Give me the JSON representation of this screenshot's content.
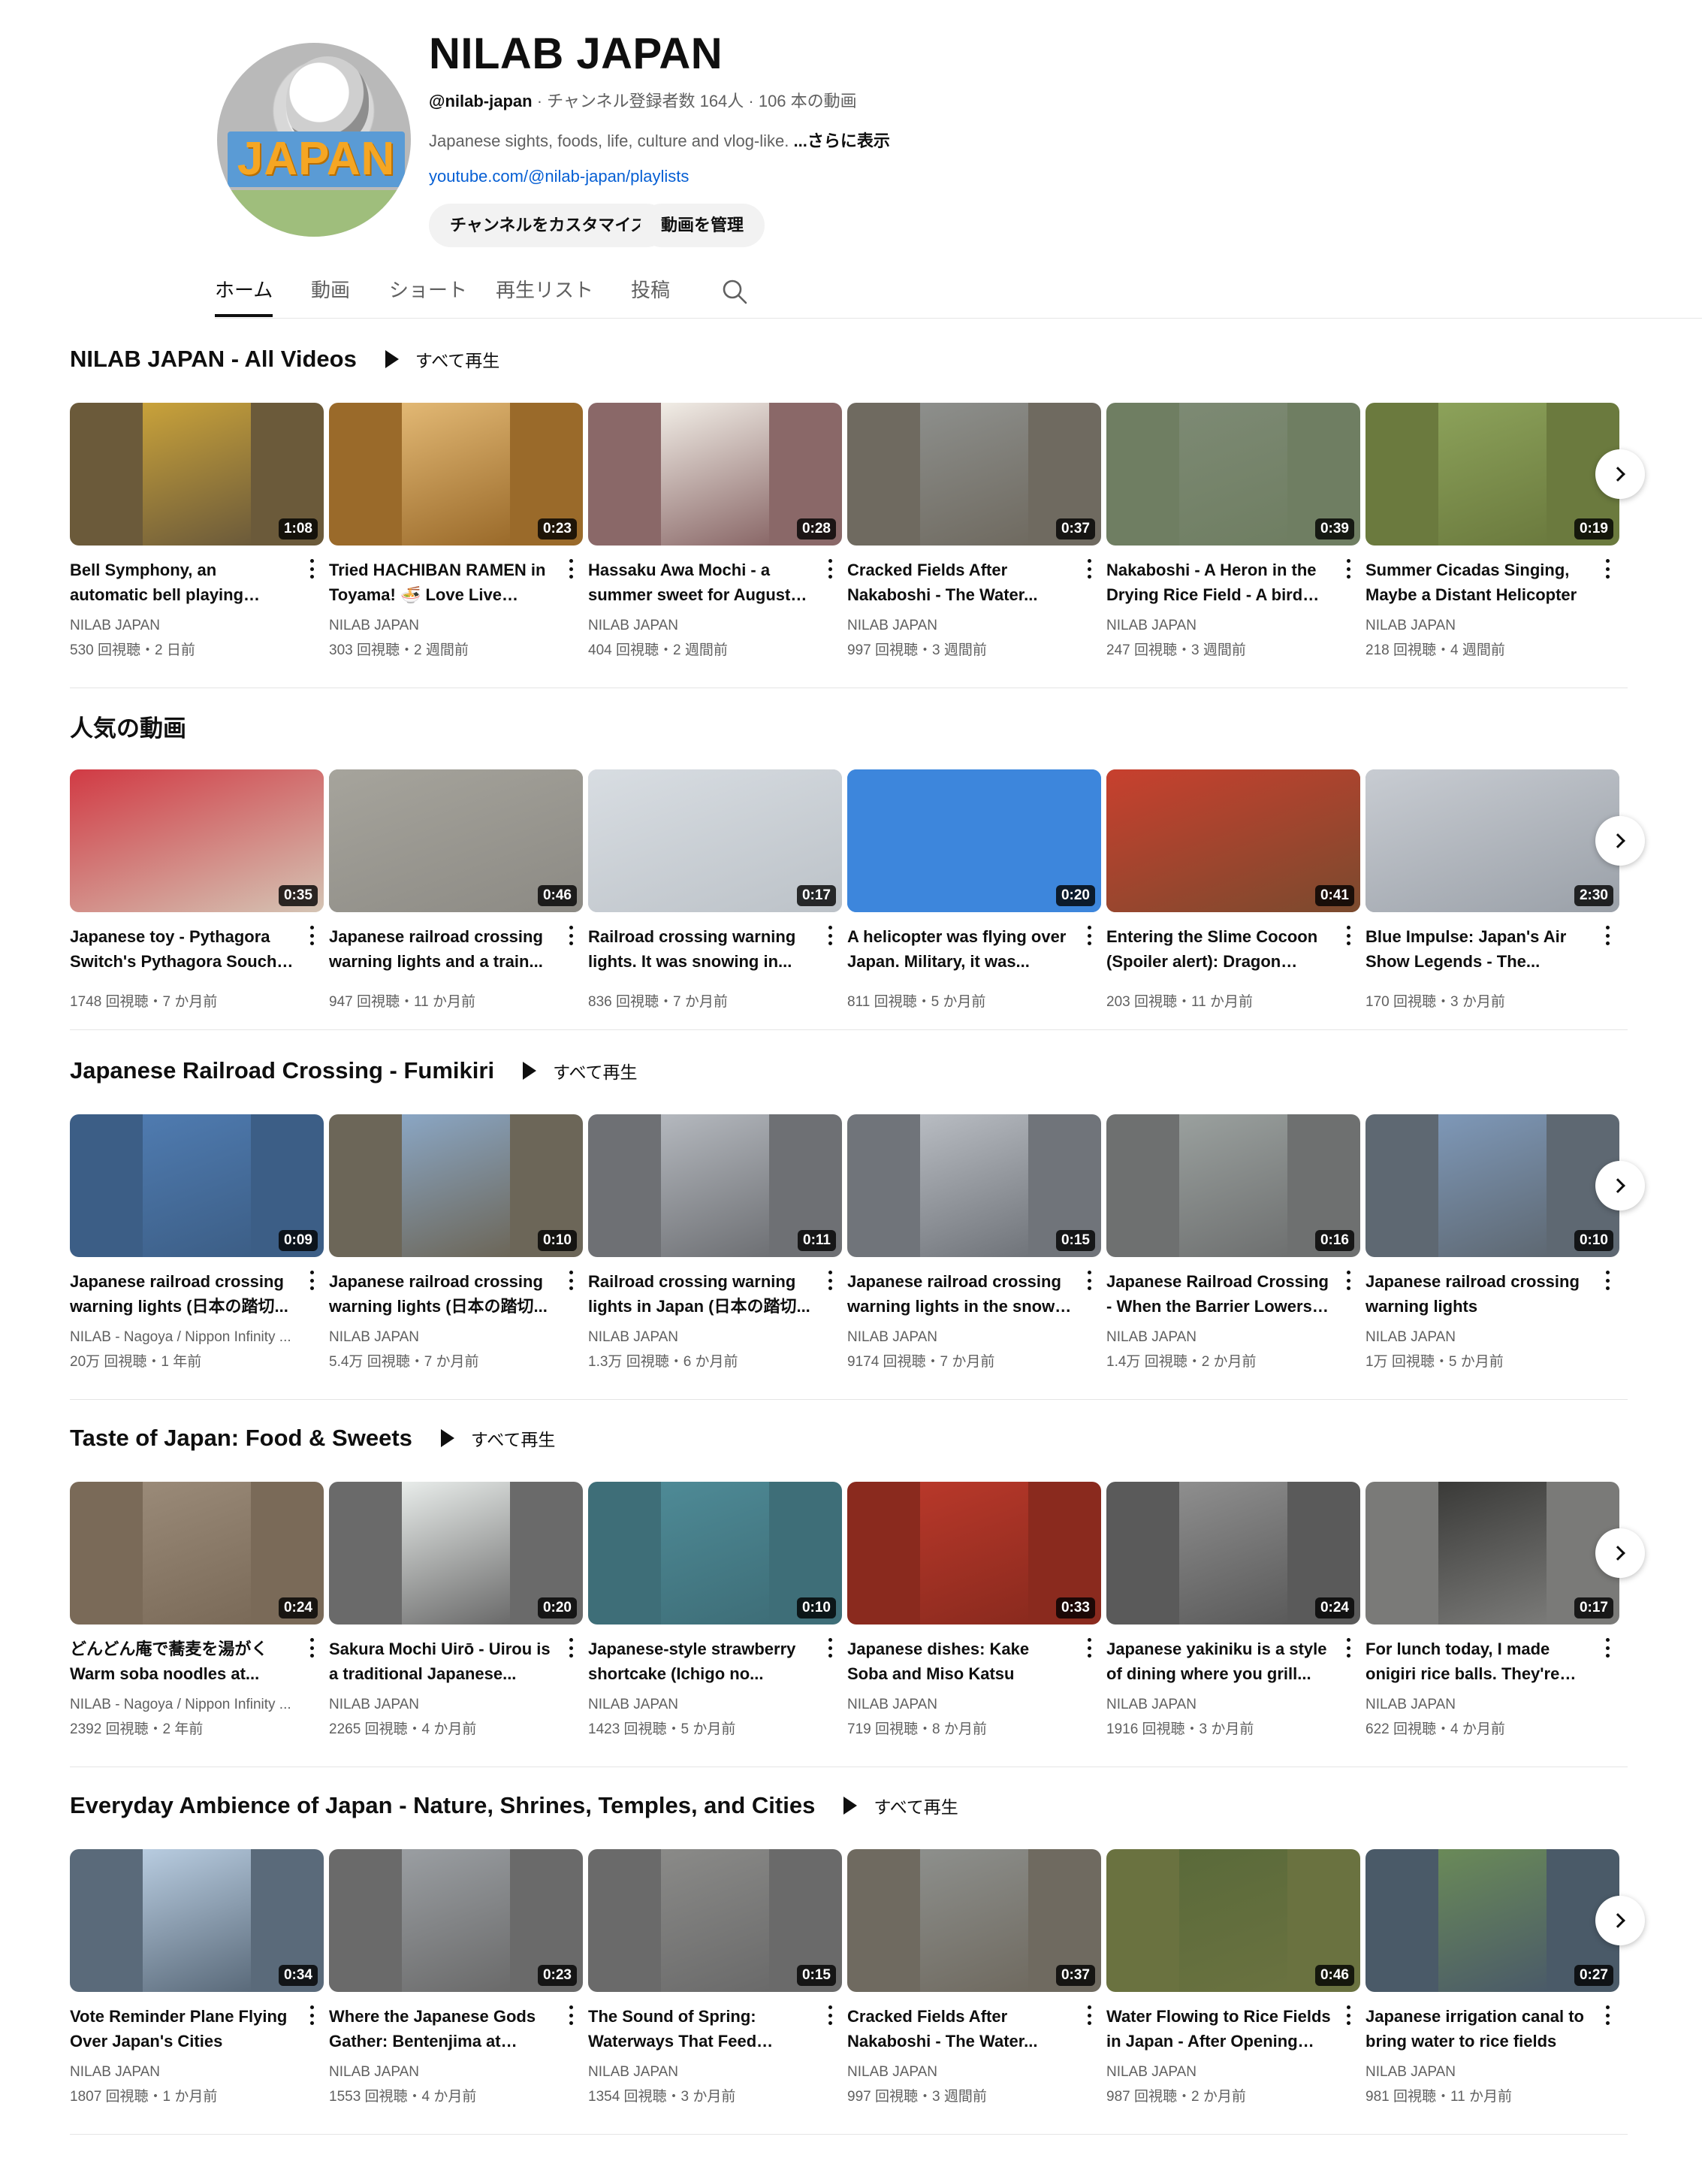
{
  "channel": {
    "title": "NILAB JAPAN",
    "avatar_text": "JAPAN",
    "handle": "@nilab-japan",
    "stats": " · チャンネル登録者数 164人 · 106 本の動画",
    "description": "Japanese sights, foods, life, culture and vlog-like. ",
    "more": "...さらに表示",
    "link": "youtube.com/@nilab-japan/playlists",
    "customize_label": "チャンネルをカスタマイズ",
    "manage_label": "動画を管理"
  },
  "tabs": [
    "ホーム",
    "動画",
    "ショート",
    "再生リスト",
    "投稿"
  ],
  "play_all_label": "すべて再生",
  "shelves": [
    {
      "title": "NILAB JAPAN - All Videos",
      "has_play_all": true,
      "videos": [
        {
          "title": "Bell Symphony, an automatic bell playing system in Chap...",
          "channel": "NILAB JAPAN",
          "meta": "530 回視聴・2 日前",
          "duration": "1:08",
          "side": "#6b5a3a",
          "main": "#c9a23a"
        },
        {
          "title": "Tried HACHIBAN RAMEN in Toyama! 🍜 Love Live Collab...",
          "channel": "NILAB JAPAN",
          "meta": "303 回視聴・2 週間前",
          "duration": "0:23",
          "side": "#9a6a2a",
          "main": "#e2b874"
        },
        {
          "title": "Hassaku Awa Mochi - a summer sweet for August -...",
          "channel": "NILAB JAPAN",
          "meta": "404 回視聴・2 週間前",
          "duration": "0:28",
          "side": "#8a6868",
          "main": "#f1ede6"
        },
        {
          "title": "Cracked Fields After Nakaboshi - The Water...",
          "channel": "NILAB JAPAN",
          "meta": "997 回視聴・3 週間前",
          "duration": "0:37",
          "side": "#6f6a60",
          "main": "#8d8f8c"
        },
        {
          "title": "Nakaboshi - A Heron in the Drying Rice Field - A bird in...",
          "channel": "NILAB JAPAN",
          "meta": "247 回視聴・3 週間前",
          "duration": "0:39",
          "side": "#6f7e62",
          "main": "#7d8a74"
        },
        {
          "title": "Summer Cicadas Singing, Maybe a Distant Helicopter",
          "channel": "NILAB JAPAN",
          "meta": "218 回視聴・4 週間前",
          "duration": "0:19",
          "side": "#6b7a3e",
          "main": "#8ca25a"
        }
      ]
    },
    {
      "title": "人気の動画",
      "has_play_all": false,
      "videos": [
        {
          "title": "Japanese toy - Pythagora Switch's Pythagora Souchi i...",
          "channel": "",
          "meta": "1748 回視聴・7 か月前",
          "duration": "0:35",
          "side": "#d4c4b4",
          "main": "#d13a44",
          "full": true
        },
        {
          "title": "Japanese railroad crossing warning lights and a train...",
          "channel": "",
          "meta": "947 回視聴・11 か月前",
          "duration": "0:46",
          "side": "#8c8a84",
          "main": "#a6a49c",
          "full": true
        },
        {
          "title": "Railroad crossing warning lights. It was snowing in...",
          "channel": "",
          "meta": "836 回視聴・7 か月前",
          "duration": "0:17",
          "side": "#bcc2c8",
          "main": "#d8dde2",
          "full": true
        },
        {
          "title": "A helicopter was flying over Japan. Military, it was...",
          "channel": "",
          "meta": "811 回視聴・5 か月前",
          "duration": "0:20",
          "side": "#3d86dc",
          "main": "#3d86dc",
          "full": true
        },
        {
          "title": "Entering the Slime Cocoon (Spoiler alert): Dragon Ques...",
          "channel": "",
          "meta": "203 回視聴・11 か月前",
          "duration": "0:41",
          "side": "#7a4a2e",
          "main": "#c8402e",
          "full": true
        },
        {
          "title": "Blue Impulse: Japan's Air Show Legends - The...",
          "channel": "",
          "meta": "170 回視聴・3 か月前",
          "duration": "2:30",
          "side": "#9aa0a8",
          "main": "#c8ccd2",
          "full": true
        }
      ]
    },
    {
      "title": "Japanese Railroad Crossing - Fumikiri",
      "has_play_all": true,
      "videos": [
        {
          "title": "Japanese railroad crossing warning lights (日本の踏切...",
          "channel": "NILAB - Nagoya / Nippon Infinity ...",
          "meta": "20万 回視聴・1 年前",
          "duration": "0:09",
          "side": "#3c5e86",
          "main": "#4f7bb0"
        },
        {
          "title": "Japanese railroad crossing warning lights (日本の踏切...",
          "channel": "NILAB JAPAN",
          "meta": "5.4万 回視聴・7 か月前",
          "duration": "0:10",
          "side": "#6c6658",
          "main": "#8aa6c4"
        },
        {
          "title": "Railroad crossing warning lights in Japan (日本の踏切...",
          "channel": "NILAB JAPAN",
          "meta": "1.3万 回視聴・6 か月前",
          "duration": "0:11",
          "side": "#6e7074",
          "main": "#b4b8be"
        },
        {
          "title": "Japanese railroad crossing warning lights in the snow (...",
          "channel": "NILAB JAPAN",
          "meta": "9174 回視聴・7 か月前",
          "duration": "0:15",
          "side": "#70747a",
          "main": "#b8bcc2"
        },
        {
          "title": "Japanese Railroad Crossing - When the Barrier Lowers, a...",
          "channel": "NILAB JAPAN",
          "meta": "1.4万 回視聴・2 か月前",
          "duration": "0:16",
          "side": "#6e7070",
          "main": "#9aa09e"
        },
        {
          "title": "Japanese railroad crossing warning lights",
          "channel": "NILAB JAPAN",
          "meta": "1万 回視聴・5 か月前",
          "duration": "0:10",
          "side": "#5e6872",
          "main": "#7e98b8"
        }
      ]
    },
    {
      "title": "Taste of Japan: Food & Sweets",
      "has_play_all": true,
      "videos": [
        {
          "title": "どんどん庵で蕎麦を湯がく Warm soba noodles at...",
          "channel": "NILAB - Nagoya / Nippon Infinity ...",
          "meta": "2392 回視聴・2 年前",
          "duration": "0:24",
          "side": "#7a6a58",
          "main": "#9a8a78"
        },
        {
          "title": "Sakura Mochi Uirō - Uirou is a traditional Japanese...",
          "channel": "NILAB JAPAN",
          "meta": "2265 回視聴・4 か月前",
          "duration": "0:20",
          "side": "#6a6a6a",
          "main": "#e8ecea"
        },
        {
          "title": "Japanese-style strawberry shortcake (Ichigo no...",
          "channel": "NILAB JAPAN",
          "meta": "1423 回視聴・5 か月前",
          "duration": "0:10",
          "side": "#3e6e78",
          "main": "#4e8a96"
        },
        {
          "title": "Japanese dishes: Kake Soba and Miso Katsu",
          "channel": "NILAB JAPAN",
          "meta": "719 回視聴・8 か月前",
          "duration": "0:33",
          "side": "#8a2a1e",
          "main": "#b8382a"
        },
        {
          "title": "Japanese yakiniku is a style of dining where you grill...",
          "channel": "NILAB JAPAN",
          "meta": "1916 回視聴・3 か月前",
          "duration": "0:24",
          "side": "#5a5a5a",
          "main": "#8e8e8e"
        },
        {
          "title": "For lunch today, I made onigiri rice balls. They're an...",
          "channel": "NILAB JAPAN",
          "meta": "622 回視聴・4 か月前",
          "duration": "0:17",
          "side": "#7a7a78",
          "main": "#3a3a38"
        }
      ]
    },
    {
      "title": "Everyday Ambience of Japan - Nature, Shrines, Temples, and Cities",
      "has_play_all": true,
      "videos": [
        {
          "title": "Vote Reminder Plane Flying Over Japan's Cities",
          "channel": "NILAB JAPAN",
          "meta": "1807 回視聴・1 か月前",
          "duration": "0:34",
          "side": "#5a6a7a",
          "main": "#b8cce0"
        },
        {
          "title": "Where the Japanese Gods Gather: Bentenjima at Inasa...",
          "channel": "NILAB JAPAN",
          "meta": "1553 回視聴・4 か月前",
          "duration": "0:23",
          "side": "#6a6a6a",
          "main": "#9a9ea2"
        },
        {
          "title": "The Sound of Spring: Waterways That Feed Japan...",
          "channel": "NILAB JAPAN",
          "meta": "1354 回視聴・3 か月前",
          "duration": "0:15",
          "side": "#6a6a6a",
          "main": "#8a8a88"
        },
        {
          "title": "Cracked Fields After Nakaboshi - The Water...",
          "channel": "NILAB JAPAN",
          "meta": "997 回視聴・3 週間前",
          "duration": "0:37",
          "side": "#6f6a60",
          "main": "#8d8f8c"
        },
        {
          "title": "Water Flowing to Rice Fields in Japan - After Opening the...",
          "channel": "NILAB JAPAN",
          "meta": "987 回視聴・2 か月前",
          "duration": "0:46",
          "side": "#6a7240",
          "main": "#5a6a3a"
        },
        {
          "title": "Japanese irrigation canal to bring water to rice fields",
          "channel": "NILAB JAPAN",
          "meta": "981 回視聴・11 か月前",
          "duration": "0:27",
          "side": "#4a5a68",
          "main": "#6a8a58"
        }
      ]
    }
  ]
}
